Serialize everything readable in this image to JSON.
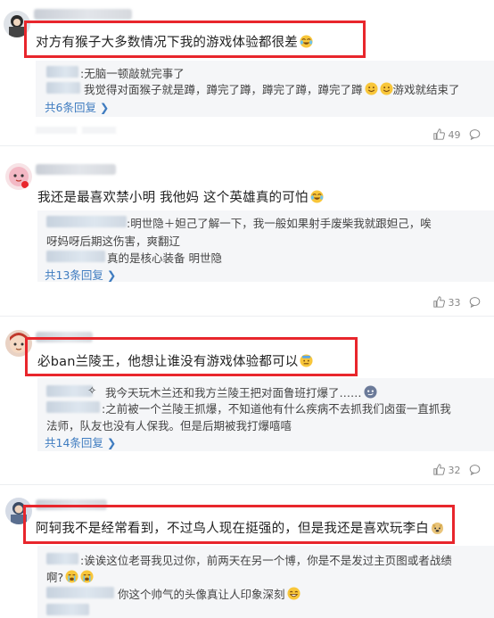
{
  "comments": [
    {
      "text": "对方有猴子大多数情况下我的游戏体验都很差",
      "emoji": "laughing-tears-emoji",
      "highlighted": true,
      "replies": [
        ":无脑一顿敲就完事了",
        "我觉得对面猴子就是蹲，蹲完了蹲，蹲完了蹲，蹲完了蹲",
        "游戏就结束了"
      ],
      "more": "共6条回复",
      "likes": "49"
    },
    {
      "text": "我还是最喜欢禁小明 我他妈 这个英雄真的可怕",
      "emoji": "laughing-tears-emoji",
      "highlighted": false,
      "replies": [
        ":明世隐＋妲己了解一下，我一般如果射手废柴我就跟妲己，唉",
        "呀妈呀后期这伤害，爽翻辽",
        "真的是核心装备 明世隐"
      ],
      "more": "共13条回复",
      "likes": "33"
    },
    {
      "text": "必ban兰陵王，他想让谁没有游戏体验都可以",
      "emoji": "sweat-emoji",
      "highlighted": true,
      "replies": [
        "我今天玩木兰还和我方兰陵王把对面鲁班打爆了……",
        ":之前被一个兰陵王抓爆，不知道他有什么疾病不去抓我们卤蛋一直抓我",
        "法师，队友也没有人保我。但是后期被我打爆嘻嘻"
      ],
      "more": "共14条回复",
      "likes": "32"
    },
    {
      "text": "阿轲我不是经常看到，不过鸟人现在挺强的，但是我还是喜欢玩李白",
      "emoji": "doge-emoji",
      "highlighted": true,
      "replies": [
        ":诶诶这位老哥我见过你，前两天在另一个博，你是不是发过主页图或者战绩",
        "啊?",
        "你这个帅气的头像真让人印象深刻"
      ]
    }
  ]
}
